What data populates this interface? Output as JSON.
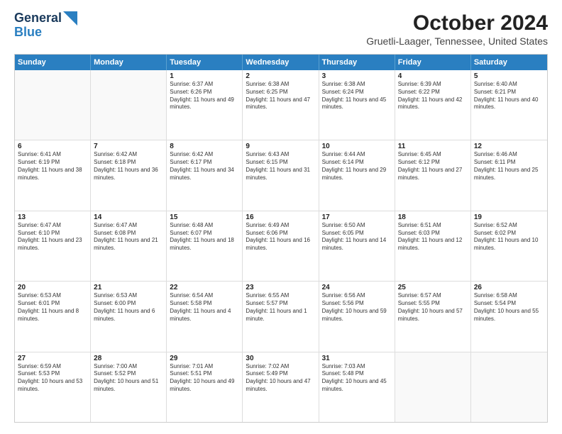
{
  "header": {
    "logo_line1": "General",
    "logo_line2": "Blue",
    "main_title": "October 2024",
    "subtitle": "Gruetli-Laager, Tennessee, United States"
  },
  "days_of_week": [
    "Sunday",
    "Monday",
    "Tuesday",
    "Wednesday",
    "Thursday",
    "Friday",
    "Saturday"
  ],
  "weeks": [
    [
      {
        "day": "",
        "text": ""
      },
      {
        "day": "",
        "text": ""
      },
      {
        "day": "1",
        "text": "Sunrise: 6:37 AM\nSunset: 6:26 PM\nDaylight: 11 hours and 49 minutes."
      },
      {
        "day": "2",
        "text": "Sunrise: 6:38 AM\nSunset: 6:25 PM\nDaylight: 11 hours and 47 minutes."
      },
      {
        "day": "3",
        "text": "Sunrise: 6:38 AM\nSunset: 6:24 PM\nDaylight: 11 hours and 45 minutes."
      },
      {
        "day": "4",
        "text": "Sunrise: 6:39 AM\nSunset: 6:22 PM\nDaylight: 11 hours and 42 minutes."
      },
      {
        "day": "5",
        "text": "Sunrise: 6:40 AM\nSunset: 6:21 PM\nDaylight: 11 hours and 40 minutes."
      }
    ],
    [
      {
        "day": "6",
        "text": "Sunrise: 6:41 AM\nSunset: 6:19 PM\nDaylight: 11 hours and 38 minutes."
      },
      {
        "day": "7",
        "text": "Sunrise: 6:42 AM\nSunset: 6:18 PM\nDaylight: 11 hours and 36 minutes."
      },
      {
        "day": "8",
        "text": "Sunrise: 6:42 AM\nSunset: 6:17 PM\nDaylight: 11 hours and 34 minutes."
      },
      {
        "day": "9",
        "text": "Sunrise: 6:43 AM\nSunset: 6:15 PM\nDaylight: 11 hours and 31 minutes."
      },
      {
        "day": "10",
        "text": "Sunrise: 6:44 AM\nSunset: 6:14 PM\nDaylight: 11 hours and 29 minutes."
      },
      {
        "day": "11",
        "text": "Sunrise: 6:45 AM\nSunset: 6:12 PM\nDaylight: 11 hours and 27 minutes."
      },
      {
        "day": "12",
        "text": "Sunrise: 6:46 AM\nSunset: 6:11 PM\nDaylight: 11 hours and 25 minutes."
      }
    ],
    [
      {
        "day": "13",
        "text": "Sunrise: 6:47 AM\nSunset: 6:10 PM\nDaylight: 11 hours and 23 minutes."
      },
      {
        "day": "14",
        "text": "Sunrise: 6:47 AM\nSunset: 6:08 PM\nDaylight: 11 hours and 21 minutes."
      },
      {
        "day": "15",
        "text": "Sunrise: 6:48 AM\nSunset: 6:07 PM\nDaylight: 11 hours and 18 minutes."
      },
      {
        "day": "16",
        "text": "Sunrise: 6:49 AM\nSunset: 6:06 PM\nDaylight: 11 hours and 16 minutes."
      },
      {
        "day": "17",
        "text": "Sunrise: 6:50 AM\nSunset: 6:05 PM\nDaylight: 11 hours and 14 minutes."
      },
      {
        "day": "18",
        "text": "Sunrise: 6:51 AM\nSunset: 6:03 PM\nDaylight: 11 hours and 12 minutes."
      },
      {
        "day": "19",
        "text": "Sunrise: 6:52 AM\nSunset: 6:02 PM\nDaylight: 11 hours and 10 minutes."
      }
    ],
    [
      {
        "day": "20",
        "text": "Sunrise: 6:53 AM\nSunset: 6:01 PM\nDaylight: 11 hours and 8 minutes."
      },
      {
        "day": "21",
        "text": "Sunrise: 6:53 AM\nSunset: 6:00 PM\nDaylight: 11 hours and 6 minutes."
      },
      {
        "day": "22",
        "text": "Sunrise: 6:54 AM\nSunset: 5:58 PM\nDaylight: 11 hours and 4 minutes."
      },
      {
        "day": "23",
        "text": "Sunrise: 6:55 AM\nSunset: 5:57 PM\nDaylight: 11 hours and 1 minute."
      },
      {
        "day": "24",
        "text": "Sunrise: 6:56 AM\nSunset: 5:56 PM\nDaylight: 10 hours and 59 minutes."
      },
      {
        "day": "25",
        "text": "Sunrise: 6:57 AM\nSunset: 5:55 PM\nDaylight: 10 hours and 57 minutes."
      },
      {
        "day": "26",
        "text": "Sunrise: 6:58 AM\nSunset: 5:54 PM\nDaylight: 10 hours and 55 minutes."
      }
    ],
    [
      {
        "day": "27",
        "text": "Sunrise: 6:59 AM\nSunset: 5:53 PM\nDaylight: 10 hours and 53 minutes."
      },
      {
        "day": "28",
        "text": "Sunrise: 7:00 AM\nSunset: 5:52 PM\nDaylight: 10 hours and 51 minutes."
      },
      {
        "day": "29",
        "text": "Sunrise: 7:01 AM\nSunset: 5:51 PM\nDaylight: 10 hours and 49 minutes."
      },
      {
        "day": "30",
        "text": "Sunrise: 7:02 AM\nSunset: 5:49 PM\nDaylight: 10 hours and 47 minutes."
      },
      {
        "day": "31",
        "text": "Sunrise: 7:03 AM\nSunset: 5:48 PM\nDaylight: 10 hours and 45 minutes."
      },
      {
        "day": "",
        "text": ""
      },
      {
        "day": "",
        "text": ""
      }
    ]
  ]
}
